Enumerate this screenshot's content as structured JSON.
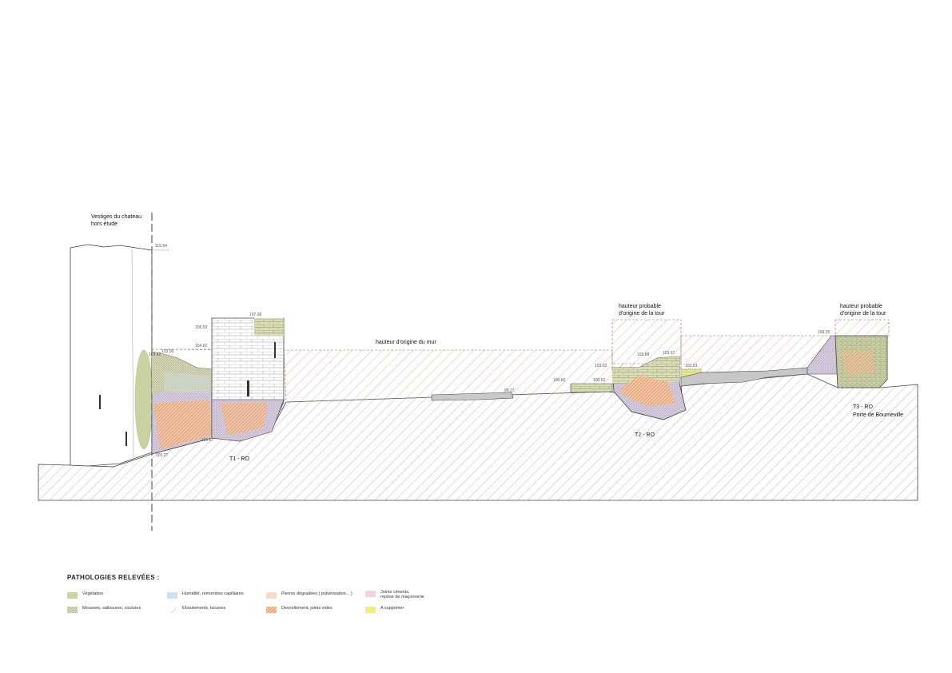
{
  "labels": {
    "chateau": "Vestiges du chateau\nhors étude",
    "mur_origine": "hauteur d'origine du mur",
    "tour_t2": "hauteur probable\nd'origine de la tour",
    "tour_t3": "hauteur probable\nd'origine de la tour",
    "t1": "T1 - RO",
    "t2": "T2 - RO",
    "t3": "T3 - RO",
    "porte": "Porte de Bourneville"
  },
  "elevations": {
    "e115": "115.64",
    "e107": "107.36",
    "e106a": "106.93",
    "e104": "104.62",
    "e103a": "103.42",
    "e103b": "103.06",
    "e101": "101.67",
    "e102a": "102.27",
    "e100a": "100.60",
    "e100b": "100.62",
    "e99": "99.27",
    "e103c": "103.88",
    "e103d": "103.67",
    "e102b": "102.02",
    "e102c": "102.03",
    "e106b": "106.25"
  },
  "legend": {
    "title": "PATHOLOGIES RELEVÉES :",
    "items": [
      {
        "label": "Végétation",
        "color": "#c9d3a1"
      },
      {
        "label": "Mousses, salissures, coulures",
        "color": "#c4c89a"
      },
      {
        "label": "Humidité, remontées capillaires",
        "color": "#cfe0f2"
      },
      {
        "label": "Eboulements, lacunes",
        "color": "#d08060"
      },
      {
        "label": "Pierres dégradées ( pulvérisation... )",
        "color": "#f7dcc0"
      },
      {
        "label": "Descellement, joints vides",
        "color": "#e07a3c"
      },
      {
        "label": "Joints ciments,\nreprise de maçonnerie",
        "color": "#f3d2e2"
      },
      {
        "label": "A supprimer",
        "color": "#f3ee78"
      }
    ]
  },
  "colors": {
    "vegetation": "#c9d3a1",
    "moss": "#c4c89a",
    "hatch_ground": "#8a8a8a",
    "hatch_lacune": "#d08060",
    "descellement": "#e07a3c",
    "degraded": "#f7dcc0",
    "humidity": "#cfe0f2",
    "cement": "#e9c9dd",
    "remove": "#f3ee78"
  }
}
